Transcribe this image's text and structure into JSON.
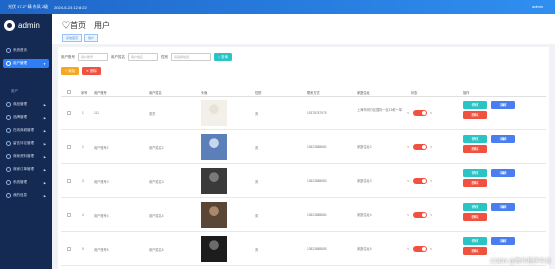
{
  "topbar": {
    "info": "光伏 17.2° 晴 东风 2级",
    "datetime": "2024-5-23 12:8:22",
    "user": "admin"
  },
  "brand": {
    "name": "admin"
  },
  "sidebar": {
    "items": [
      {
        "label": "系统首页"
      },
      {
        "label": "用户管理"
      },
      {
        "label": "商品管理"
      },
      {
        "label": "品牌管理"
      },
      {
        "label": "在线商城管理"
      },
      {
        "label": "留言评论管理"
      },
      {
        "label": "商家资料管理"
      },
      {
        "label": "商家订单管理"
      },
      {
        "label": "系统管理"
      },
      {
        "label": "我的信息"
      }
    ],
    "sub_item": "用户"
  },
  "header": {
    "title_prefix": "首页",
    "title": "用户",
    "breadcrumbs": [
      "系统首页",
      "用户"
    ]
  },
  "search": {
    "field1_label": "用户账号",
    "field1_placeholder": "用户账号",
    "field2_label": "用户姓名",
    "field2_placeholder": "用户姓名",
    "field3_label": "性别",
    "field3_placeholder": "请选择性别",
    "button": "查询"
  },
  "actions": {
    "add": "添加",
    "delete": "删除"
  },
  "table": {
    "columns": [
      "序号",
      "用户账号",
      "用户姓名",
      "头像",
      "性别",
      "联系方式",
      "家庭住址",
      "状态",
      "操作"
    ],
    "rows": [
      {
        "idx": "1",
        "account": "111",
        "name": "燕芳",
        "gender": "男",
        "phone": "15378787975",
        "address": "上海市闵行区国际一区15栋一单",
        "op_edit": "修改",
        "op_detail": "详情",
        "op_delete": "删除"
      },
      {
        "idx": "2",
        "account": "用户账号2",
        "name": "用户姓名2",
        "gender": "男",
        "phone": "13823888882",
        "address": "家庭住址2",
        "op_edit": "修改",
        "op_detail": "详情",
        "op_delete": "删除"
      },
      {
        "idx": "3",
        "account": "用户账号3",
        "name": "用户姓名3",
        "gender": "男",
        "phone": "13823888883",
        "address": "家庭住址3",
        "op_edit": "修改",
        "op_detail": "详情",
        "op_delete": "删除"
      },
      {
        "idx": "4",
        "account": "用户账号4",
        "name": "用户姓名4",
        "gender": "男",
        "phone": "13823888884",
        "address": "家庭住址4",
        "op_edit": "修改",
        "op_detail": "详情",
        "op_delete": "删除"
      },
      {
        "idx": "5",
        "account": "用户账号5",
        "name": "用户姓名5",
        "gender": "男",
        "phone": "13823888885",
        "address": "家庭住址5",
        "op_edit": "修改",
        "op_detail": "详情",
        "op_delete": "删除"
      }
    ]
  },
  "watermark": "CSDN @新作程序毕设",
  "colors": {
    "sidebar": "#142a52",
    "accent": "#2f7ef5",
    "danger": "#f0523f",
    "teal": "#2bc4c4"
  }
}
